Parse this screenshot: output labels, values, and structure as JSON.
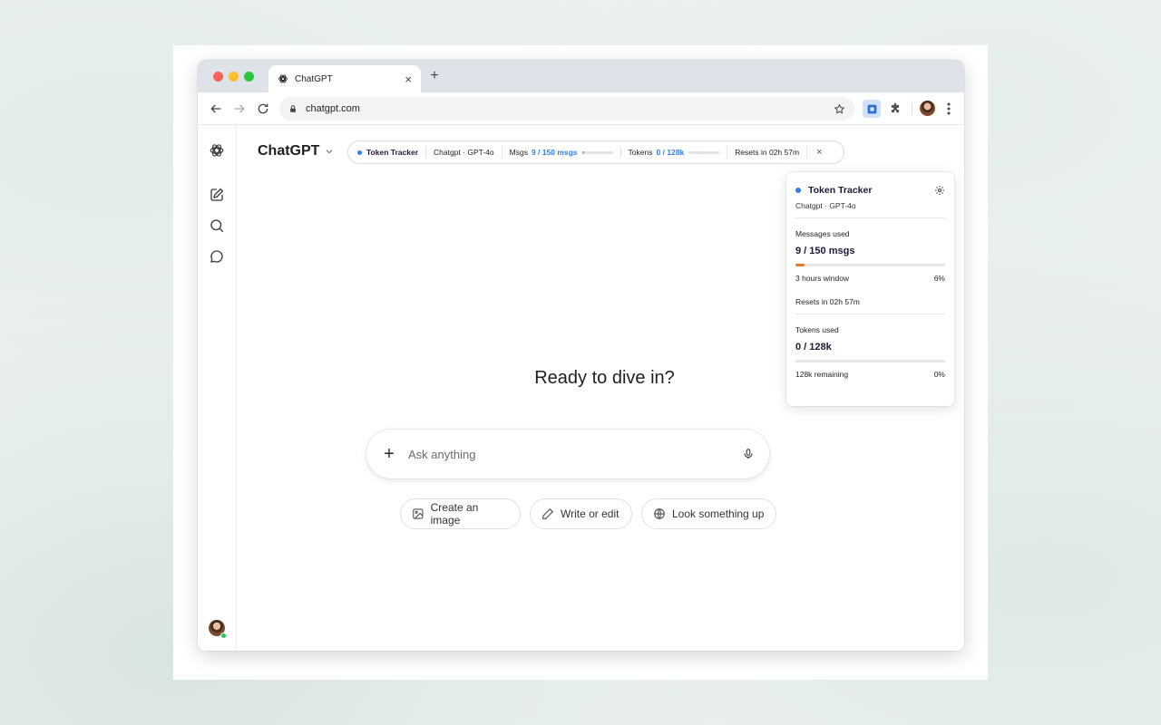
{
  "browser": {
    "tab_title": "ChatGPT",
    "tab_close": "×",
    "new_tab": "+",
    "url": "chatgpt.com"
  },
  "app": {
    "model_name": "ChatGPT",
    "hero": "Ready to dive in?",
    "composer": {
      "placeholder": "Ask anything",
      "plus": "+"
    },
    "chips": [
      {
        "label": "Create an image",
        "icon": "image-icon"
      },
      {
        "label": "Write or edit",
        "icon": "pencil-icon"
      },
      {
        "label": "Look something up",
        "icon": "globe-icon"
      }
    ]
  },
  "tracker_bar": {
    "title": "Token Tracker",
    "model": "Chatgpt · GPT-4o",
    "msgs_label": "Msgs",
    "msgs_value": "9 / 150 msgs",
    "msgs_fraction": 0.06,
    "tokens_label": "Tokens",
    "tokens_value": "0 / 128k",
    "tokens_fraction": 0,
    "resets": "Resets in 02h 57m",
    "close": "×"
  },
  "panel": {
    "title": "Token Tracker",
    "subtitle": "Chatgpt · GPT-4o",
    "messages_label": "Messages used",
    "messages_value": "9 / 150 msgs",
    "messages_fraction": 0.06,
    "window_label": "3 hours window",
    "messages_percent": "6%",
    "resets": "Resets in 02h 57m",
    "tokens_label": "Tokens used",
    "tokens_value": "0 / 128k",
    "tokens_fraction": 0,
    "remaining_label": "128k remaining",
    "tokens_percent": "0%"
  },
  "colors": {
    "accent_blue": "#2f80ed",
    "messages_bar": "#e8772e"
  }
}
